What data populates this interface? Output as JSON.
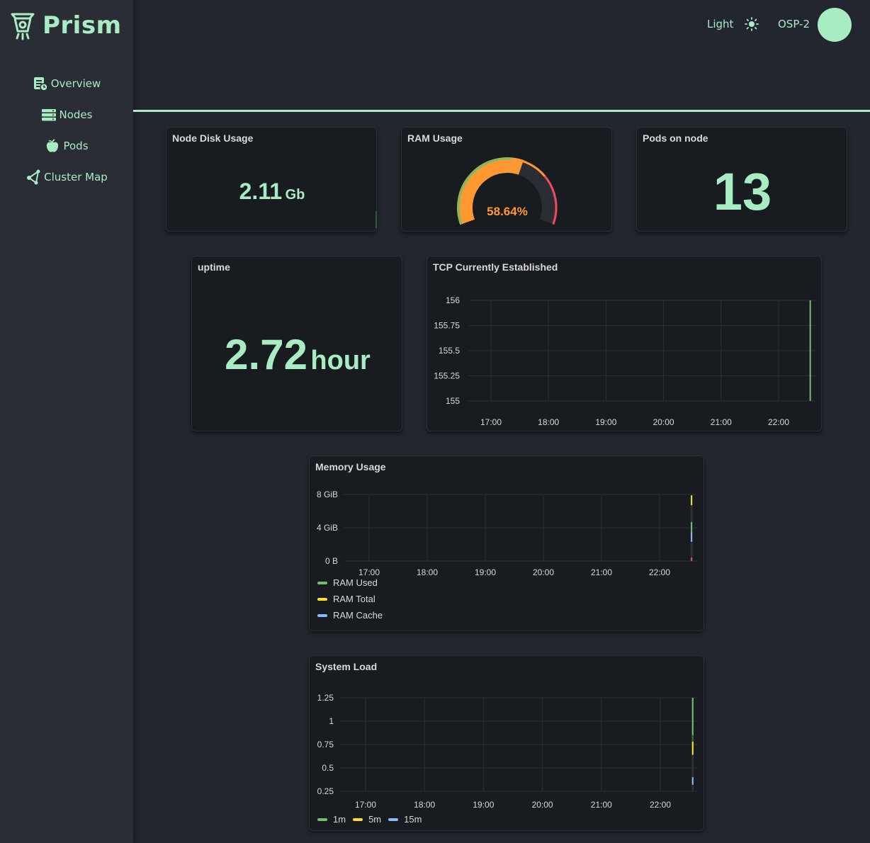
{
  "app": {
    "name": "Prism"
  },
  "sidebar": {
    "items": [
      {
        "label": "Overview",
        "icon": "document-chart-icon"
      },
      {
        "label": "Nodes",
        "icon": "server-stack-icon"
      },
      {
        "label": "Pods",
        "icon": "apple-icon"
      },
      {
        "label": "Cluster Map",
        "icon": "network-share-icon"
      }
    ]
  },
  "header": {
    "theme_label": "Light",
    "theme_icon": "sun-icon",
    "user": "OSP-2"
  },
  "colors": {
    "accent": "#a8ecc1",
    "panel_bg": "#181b1f",
    "page_bg": "#23262e",
    "gauge_orange": "#ff9830",
    "series_green": "#73bf69",
    "series_yellow": "#fade2a",
    "series_blue": "#8ab8ff",
    "series_red": "#f2495c"
  },
  "panels": {
    "disk": {
      "title": "Node Disk Usage",
      "value": "2.11",
      "unit": "Gb"
    },
    "ram": {
      "title": "RAM Usage",
      "value": "58.64%",
      "percent": 58.64
    },
    "pods": {
      "title": "Pods on node",
      "value": "13"
    },
    "uptime": {
      "title": "uptime",
      "value": "2.72",
      "unit": "hour"
    },
    "tcp": {
      "title": "TCP Currently Established"
    },
    "memory": {
      "title": "Memory Usage"
    },
    "load": {
      "title": "System Load"
    }
  },
  "chart_data": [
    {
      "type": "line",
      "title": "TCP Currently Established",
      "x_ticks": [
        "17:00",
        "18:00",
        "19:00",
        "20:00",
        "21:00",
        "22:00"
      ],
      "y_ticks": [
        "156",
        "155.75",
        "155.5",
        "155.25",
        "155"
      ],
      "ylim": [
        155,
        156
      ],
      "grid": true,
      "series": [
        {
          "color": "#73bf69",
          "x": [
            "22:33",
            "22:33"
          ],
          "values": [
            155,
            156
          ]
        }
      ]
    },
    {
      "type": "line",
      "title": "Memory Usage",
      "x_ticks": [
        "17:00",
        "18:00",
        "19:00",
        "20:00",
        "21:00",
        "22:00"
      ],
      "y_ticks": [
        "8 GiB",
        "4 GiB",
        "0 B"
      ],
      "ylim": [
        0,
        8
      ],
      "grid": true,
      "legend_placement": "bottom",
      "series": [
        {
          "name": "RAM Used",
          "color": "#73bf69",
          "x": [
            "22:33"
          ],
          "values": [
            4.7
          ]
        },
        {
          "name": "RAM Total",
          "color": "#fade2a",
          "x": [
            "22:33"
          ],
          "values": [
            7.9
          ]
        },
        {
          "name": "RAM Cache",
          "color": "#8ab8ff",
          "x": [
            "22:33"
          ],
          "values": [
            3.5
          ]
        }
      ]
    },
    {
      "type": "line",
      "title": "System Load",
      "x_ticks": [
        "17:00",
        "18:00",
        "19:00",
        "20:00",
        "21:00",
        "22:00"
      ],
      "y_ticks": [
        "1.25",
        "1",
        "0.75",
        "0.5",
        "0.25"
      ],
      "ylim": [
        0.25,
        1.25
      ],
      "grid": true,
      "legend_placement": "bottom",
      "series": [
        {
          "name": "1m",
          "color": "#73bf69",
          "x": [
            "22:33"
          ],
          "values": [
            1.25
          ]
        },
        {
          "name": "5m",
          "color": "#fade2a",
          "x": [
            "22:33"
          ],
          "values": [
            0.78
          ]
        },
        {
          "name": "15m",
          "color": "#8ab8ff",
          "x": [
            "22:33"
          ],
          "values": [
            0.4
          ]
        }
      ]
    }
  ]
}
